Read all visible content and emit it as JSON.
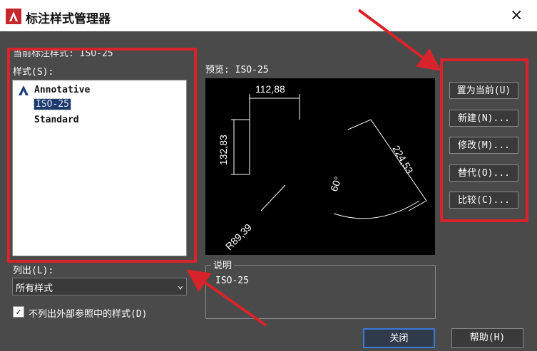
{
  "window": {
    "title": "标注样式管理器",
    "close_glyph": "×"
  },
  "current_style": "当前标注样式: ISO-25",
  "styles_label": "样式(S):",
  "styles": [
    {
      "label": "Annotative",
      "icon": "annotative-icon",
      "selected": false
    },
    {
      "label": "ISO-25",
      "icon": "",
      "selected": true
    },
    {
      "label": "Standard",
      "icon": "",
      "selected": false
    }
  ],
  "list_label": "列出(L):",
  "list_select": {
    "value": "所有样式",
    "arrow": "⌄"
  },
  "xref_checkbox": {
    "checked": true,
    "mark": "✓",
    "label": "不列出外部参照中的样式(D)"
  },
  "preview": {
    "label": "预览: ISO-25",
    "dims": {
      "linear_h": "112,88",
      "linear_v": "132,83",
      "aligned": "224,53",
      "angle": "60°",
      "radius": "R89,39"
    }
  },
  "description": {
    "label": "说明",
    "text": "ISO-25"
  },
  "buttons": {
    "set_current": "置为当前(U)",
    "new": "新建(N)...",
    "modify": "修改(M)...",
    "override": "替代(O)...",
    "compare": "比较(C)...",
    "close": "关闭",
    "help": "帮助(H)"
  },
  "colors": {
    "highlight_red": "#d9232a",
    "accent_blue": "#3b78d8",
    "dialog_bg": "#4a4a4a"
  }
}
